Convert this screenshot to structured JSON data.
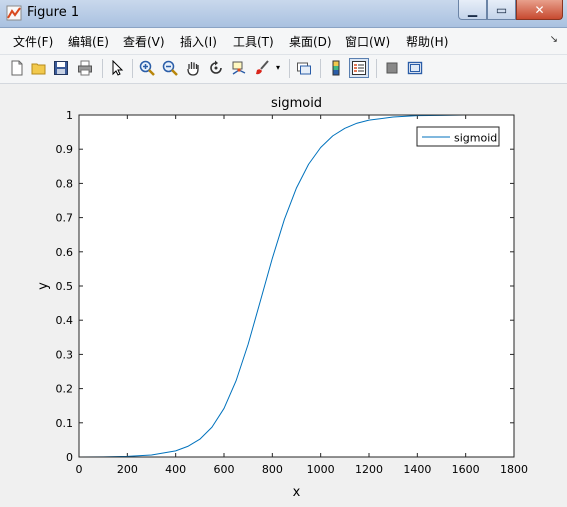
{
  "window": {
    "title": "Figure 1"
  },
  "menu": [
    "文件(F)",
    "编辑(E)",
    "查看(V)",
    "插入(I)",
    "工具(T)",
    "桌面(D)",
    "窗口(W)",
    "帮助(H)"
  ],
  "menu_overflow_icon": "double-chevron-icon",
  "toolbar": [
    "new-figure-icon",
    "open-file-icon",
    "save-icon",
    "print-icon",
    "pointer-icon",
    "zoom-in-icon",
    "zoom-out-icon",
    "pan-hand-icon",
    "rotate-3d-icon",
    "data-cursor-icon",
    "brush-icon",
    "link-plot-icon",
    "colorbar-icon",
    "legend-icon",
    "hide-plot-tools-icon",
    "show-plot-tools-icon"
  ],
  "chart_data": {
    "type": "line",
    "title": "sigmoid",
    "xlabel": "x",
    "ylabel": "y",
    "xlim": [
      0,
      1800
    ],
    "ylim": [
      0,
      1
    ],
    "xticks": [
      0,
      200,
      400,
      600,
      800,
      1000,
      1200,
      1400,
      1600,
      1800
    ],
    "yticks": [
      0,
      0.1,
      0.2,
      0.3,
      0.4,
      0.5,
      0.6,
      0.7,
      0.8,
      0.9,
      1
    ],
    "xtick_labels": [
      "0",
      "200",
      "400",
      "600",
      "800",
      "1000",
      "1200",
      "1400",
      "1600",
      "1800"
    ],
    "ytick_labels": [
      "0",
      "0.1",
      "0.2",
      "0.3",
      "0.4",
      "0.5",
      "0.6",
      "0.7",
      "0.8",
      "0.9",
      "1"
    ],
    "grid": false,
    "legend_position": "top-right",
    "series": [
      {
        "name": "sigmoid",
        "color": "#0072bd",
        "x": [
          0,
          100,
          200,
          300,
          400,
          450,
          500,
          550,
          600,
          650,
          700,
          750,
          800,
          850,
          900,
          950,
          1000,
          1050,
          1100,
          1150,
          1200,
          1300,
          1400,
          1500,
          1600
        ],
        "y": [
          0.0,
          0.0005,
          0.002,
          0.006,
          0.018,
          0.031,
          0.052,
          0.087,
          0.142,
          0.223,
          0.33,
          0.455,
          0.581,
          0.695,
          0.787,
          0.856,
          0.905,
          0.939,
          0.961,
          0.976,
          0.985,
          0.994,
          0.998,
          0.999,
          1.0
        ]
      }
    ]
  }
}
